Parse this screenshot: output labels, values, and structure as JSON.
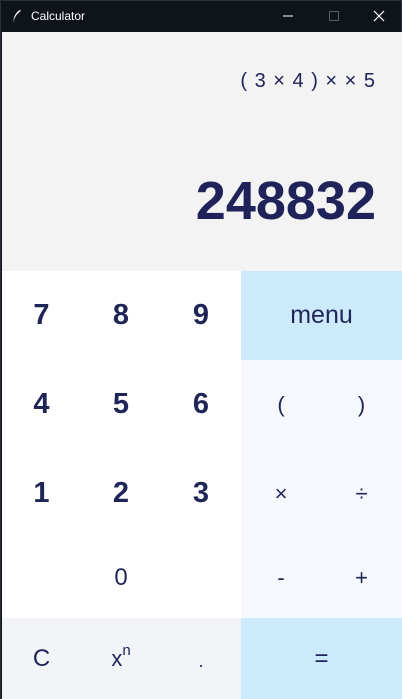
{
  "window": {
    "title": "Calculator",
    "icon": "feather-icon",
    "controls": {
      "minimize": "minimize-icon",
      "maximize": "maximize-icon",
      "close": "close-icon"
    }
  },
  "display": {
    "expression": "( 3 × 4 )  ×  × 5",
    "result": "248832"
  },
  "keys": {
    "seven": "7",
    "eight": "8",
    "nine": "9",
    "menu": "menu",
    "four": "4",
    "five": "5",
    "six": "6",
    "open_paren": "(",
    "close_paren": ")",
    "one": "1",
    "two": "2",
    "three": "3",
    "multiply": "×",
    "divide": "÷",
    "zero": "0",
    "minus": "-",
    "plus": "+",
    "clear": "C",
    "power_base": "x",
    "power_exp": "n",
    "decimal": ".",
    "equals": "="
  },
  "colors": {
    "text": "#20235a",
    "display_bg": "#f3f3f3",
    "accent_bg": "#cdeafc",
    "operator_bg": "#f7f8fd",
    "titlebar_bg": "#0f141b"
  }
}
